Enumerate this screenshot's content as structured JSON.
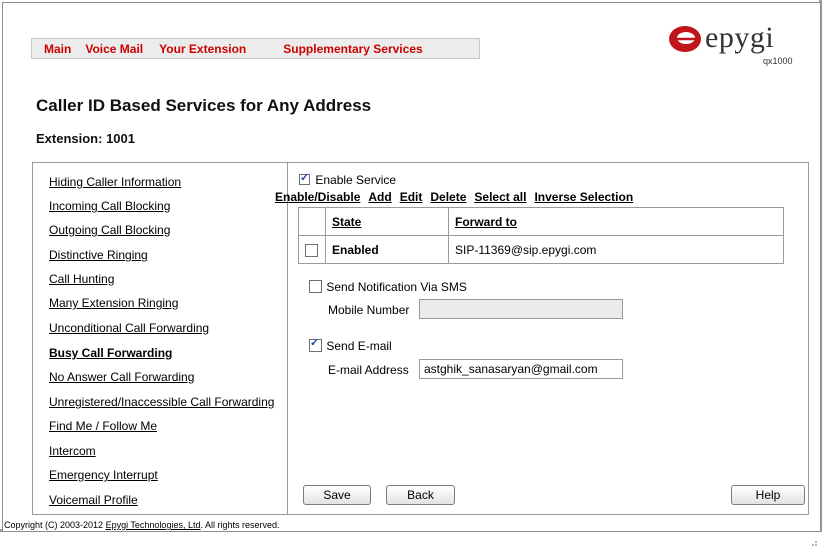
{
  "nav": {
    "items": [
      "Main",
      "Voice Mail",
      "Your Extension",
      "Supplementary Services"
    ]
  },
  "logo": {
    "word": "epygi",
    "model": "qx1000"
  },
  "page": {
    "title": "Caller ID Based Services for Any Address",
    "extension": "Extension: 1001"
  },
  "sidebar": {
    "items": [
      {
        "label": "Hiding Caller Information",
        "active": false
      },
      {
        "label": "Incoming Call Blocking",
        "active": false
      },
      {
        "label": "Outgoing Call Blocking",
        "active": false
      },
      {
        "label": "Distinctive Ringing",
        "active": false
      },
      {
        "label": "Call Hunting",
        "active": false
      },
      {
        "label": "Many Extension Ringing",
        "active": false
      },
      {
        "label": "Unconditional Call Forwarding",
        "active": false
      },
      {
        "label": "Busy Call Forwarding",
        "active": true
      },
      {
        "label": "No Answer Call Forwarding",
        "active": false
      },
      {
        "label": "Unregistered/Inaccessible Call Forwarding",
        "active": false
      },
      {
        "label": "Find Me / Follow Me",
        "active": false
      },
      {
        "label": "Intercom",
        "active": false
      },
      {
        "label": "Emergency Interrupt",
        "active": false
      },
      {
        "label": "Voicemail Profile",
        "active": false
      }
    ]
  },
  "service": {
    "enable_label": "Enable Service",
    "enabled": true
  },
  "toolbar": {
    "actions": [
      "Enable/Disable",
      "Add",
      "Edit",
      "Delete",
      "Select all",
      "Inverse Selection"
    ]
  },
  "rules_table": {
    "headers": [
      "State",
      "Forward to"
    ],
    "rows": [
      {
        "state": "Enabled",
        "forward_to": "SIP-11369@sip.epygi.com",
        "selected": false
      }
    ]
  },
  "sms": {
    "label": "Send Notification Via SMS",
    "checked": false,
    "mobile_label": "Mobile Number",
    "mobile_value": ""
  },
  "email": {
    "label": "Send E-mail",
    "checked": true,
    "address_label": "E-mail Address",
    "address_value": "astghik_sanasaryan@gmail.com"
  },
  "buttons": {
    "save": "Save",
    "back": "Back",
    "help": "Help"
  },
  "footer": {
    "prefix": "Copyright (C) 2003-2012 ",
    "company": "Epygi Technologies, Ltd",
    "suffix": ". All rights reserved."
  },
  "colors": {
    "nav_text": "#cc0000",
    "logo_red": "#c0161b",
    "check": "#1a4da8"
  }
}
